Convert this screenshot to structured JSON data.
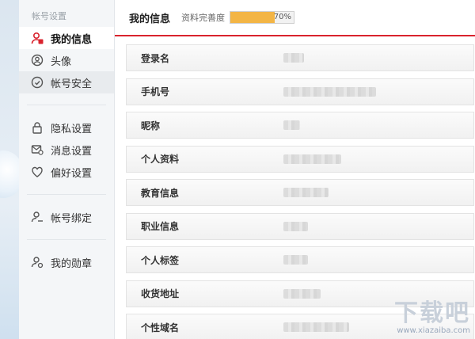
{
  "sidebar": {
    "header": "帐号设置",
    "groups": [
      [
        {
          "label": "我的信息",
          "icon": "user-icon",
          "active": true
        },
        {
          "label": "头像",
          "icon": "avatar-icon"
        },
        {
          "label": "帐号安全",
          "icon": "shield-icon",
          "hovered": true
        }
      ],
      [
        {
          "label": "隐私设置",
          "icon": "lock-icon"
        },
        {
          "label": "消息设置",
          "icon": "message-icon"
        },
        {
          "label": "偏好设置",
          "icon": "heart-icon"
        }
      ],
      [
        {
          "label": "帐号绑定",
          "icon": "user-link-icon"
        }
      ],
      [
        {
          "label": "我的勋章",
          "icon": "medal-icon"
        }
      ]
    ]
  },
  "main": {
    "title": "我的信息",
    "completion_label": "资料完善度",
    "completion_percent": 70,
    "completion_text": "70%",
    "accent_color": "#d9232e",
    "progress_color": "#f3b545",
    "rows": [
      {
        "label": "登录名",
        "blur_fraction": 0.1
      },
      {
        "label": "手机号",
        "blur_fraction": 0.45
      },
      {
        "label": "昵称",
        "blur_fraction": 0.08
      },
      {
        "label": "个人资料",
        "blur_fraction": 0.28
      },
      {
        "label": "教育信息",
        "blur_fraction": 0.22
      },
      {
        "label": "职业信息",
        "blur_fraction": 0.12
      },
      {
        "label": "个人标签",
        "blur_fraction": 0.12
      },
      {
        "label": "收货地址",
        "blur_fraction": 0.18
      },
      {
        "label": "个性域名",
        "blur_fraction": 0.32
      }
    ]
  },
  "watermark": {
    "text": "下载吧",
    "url": "www.xiazaiba.com"
  }
}
